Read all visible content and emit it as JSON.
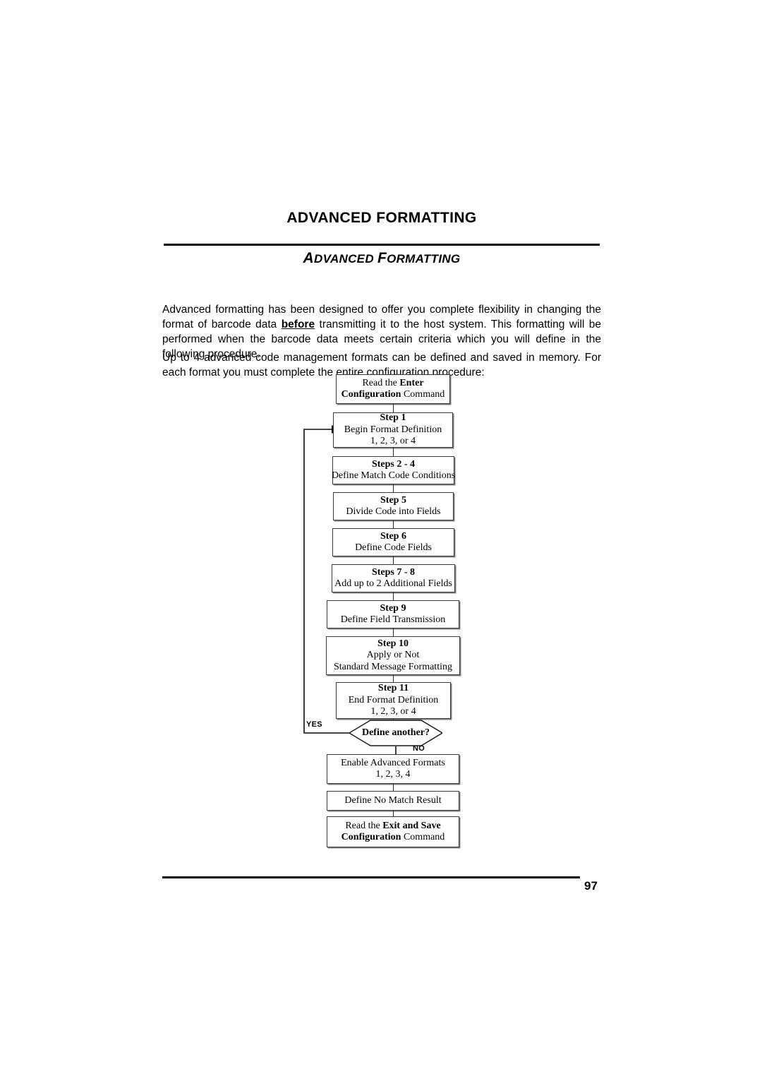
{
  "header": {
    "running_head": "ADVANCED FORMATTING",
    "section_title_lead": "A",
    "section_title_rest": "DVANCED ",
    "section_title_lead2": "F",
    "section_title_rest2": "ORMATTING"
  },
  "body": {
    "paragraph_1_part1": "Advanced formatting has been designed to offer you complete flexibility in changing the format of barcode data ",
    "paragraph_1_emphasis": "before",
    "paragraph_1_part2": " transmitting it to the host system. This formatting will be performed when the barcode data meets certain criteria which you will define in the following procedure.",
    "paragraph_2": "Up to 4 advanced code management formats can be defined and saved in memory. For each format you must complete the entire configuration procedure:"
  },
  "flowchart": {
    "nodes": [
      {
        "id": "enter-config",
        "lines": [
          {
            "text": "Read the ",
            "bold": false,
            "inline_bold": "Enter"
          },
          {
            "text": "Configuration",
            "bold": true,
            "suffix": " Command"
          }
        ],
        "line1_plain": "Read the ",
        "line1_bold": "Enter",
        "line2_bold": "Configuration",
        "line2_plain": " Command"
      },
      {
        "id": "step-1",
        "title": "Step 1",
        "line2": "Begin Format Definition",
        "line3": "1, 2, 3, or 4"
      },
      {
        "id": "steps-2-4",
        "title": "Steps 2 - 4",
        "line2": "Define Match Code Conditions"
      },
      {
        "id": "step-5",
        "title": "Step 5",
        "line2": "Divide Code into Fields"
      },
      {
        "id": "step-6",
        "title": "Step 6",
        "line2": "Define Code Fields"
      },
      {
        "id": "steps-7-8",
        "title": "Steps 7 - 8",
        "line2": "Add up to 2 Additional Fields"
      },
      {
        "id": "step-9",
        "title": "Step 9",
        "line2": "Define Field Transmission"
      },
      {
        "id": "step-10",
        "title": "Step 10",
        "line2": "Apply or Not",
        "line3": "Standard Message Formatting"
      },
      {
        "id": "step-11",
        "title": "Step 11",
        "line2": "End Format Definition",
        "line3": "1, 2, 3, or 4"
      },
      {
        "id": "enable-formats",
        "line1": "Enable Advanced Formats",
        "line2": "1, 2, 3, 4"
      },
      {
        "id": "no-match",
        "line1": "Define No Match Result"
      },
      {
        "id": "exit-save",
        "line1_plain": "Read the ",
        "line1_bold": "Exit and Save",
        "line2_bold": "Configuration",
        "line2_plain": " Command"
      }
    ],
    "decision": {
      "label": "Define another?",
      "yes_label": "YES",
      "no_label": "NO"
    }
  },
  "footer": {
    "page_number": "97"
  }
}
